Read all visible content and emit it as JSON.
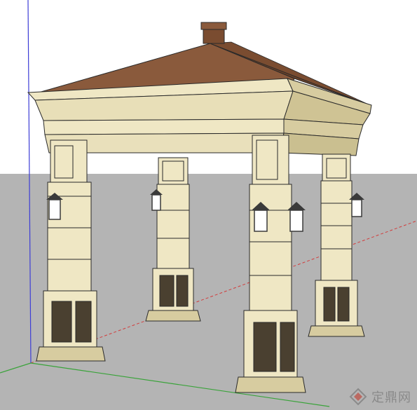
{
  "scene": {
    "description_label": "gazebo-3d-model",
    "colors": {
      "sky": "#ffffff",
      "ground": "#b4b4b4",
      "stone": "#efe7c4",
      "stone_shade": "#d7cca0",
      "stone_dark": "#bfb283",
      "roof": "#8a5a3c",
      "roof_dark": "#6b4128",
      "axis_blue": "#3d3dd6",
      "axis_red": "#d23c3c",
      "axis_green": "#3aa33a",
      "outline": "#2a2a2a",
      "lamp": "#3a3a3a"
    }
  },
  "watermark": {
    "text": "定鼎网"
  }
}
